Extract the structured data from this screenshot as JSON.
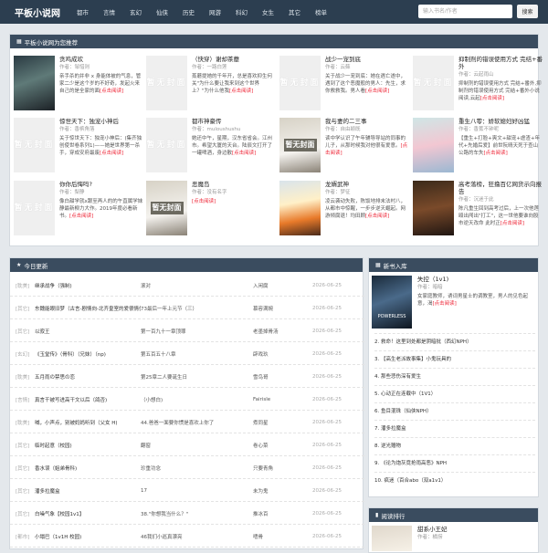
{
  "header": {
    "logo": "平板小说网",
    "nav": [
      "都市",
      "言情",
      "玄幻",
      "仙侠",
      "历史",
      "网游",
      "科幻",
      "女生",
      "其它",
      "榜单"
    ],
    "search_placeholder": "输入书名/作者",
    "search_button": "搜索"
  },
  "recommend": {
    "title": "平板小说网为您推荐",
    "books": [
      {
        "title": "贪鸡成欢",
        "author": "作者：邹惜则",
        "desc": "亲手杀的并非 x 身能体被的气息，管家二少是这个岁的不好奇，发起火来自己的是全家的面",
        "more": "[点击阅读]"
      },
      {
        "title": "（快穿）谢却茶蘼",
        "author": "作者：一路白莲",
        "desc": "蒸蘑提她的千年开，总是喜欢抑生何关\"为什么要让我来到这个世界上？\"为什么他我",
        "more": "[点击阅读]"
      },
      {
        "title": "战少一宠到底",
        "author": "作者：云藓",
        "desc": "关于战少一宠到底：她在遇亡遂中，遇到了这个恶魔般的男人：先生，求你救救我。男人看",
        "more": "[点击阅读]"
      },
      {
        "title": "抑制剂的错误使用方式 完结+番外",
        "author": "作者：云起雨山",
        "desc": "抑制剂的错误使用方式 完结+番外,抑制剂的错误使用方式 完结+番外小说阅读,云起",
        "more": "[点击阅读]"
      },
      {
        "title": "惊世天下：独宠小神后",
        "author": "作者：香槟角落",
        "desc": "关于惊世天下：独宠小神后：(集齐独创使世卷系列1)——她是世界第一杀手，穿成安府最废",
        "more": "[点击阅读]"
      },
      {
        "title": "都市神豪传",
        "author": "作者：muloushushu",
        "desc": "她还中午，星期，汉东省省会。江州市。希望大厦的天台。陆辰文打开了一罐啤酒，身边散",
        "more": "[点击阅读]"
      },
      {
        "title": "我与妻的二三事",
        "author": "作者：自由颖既",
        "desc": "读中学认识了午年辅导导站的同事的儿子，从那时候我对他很有爱意。",
        "more": "[点击阅读]"
      },
      {
        "title": "重生八零：娇软媳妇好凶猛",
        "author": "作者：香蕉不钟呢",
        "desc": "【重生+打脸+爽文+甜宠+虐渣+年代+先婚后爱】前世阮晴天死于查山公路的车失",
        "more": "[点击阅读]"
      },
      {
        "title": "你你后悔吗?",
        "author": "作者：梨静",
        "desc": "像白甜学就x跟至再人的的午直属学妹静最新柳力大作。2019年度必看新书。",
        "more": "[点击阅读]"
      },
      {
        "title": "恶魔岛",
        "author": "作者：没有名字",
        "desc": "",
        "more": "[点击阅读]"
      },
      {
        "title": "龙婿武神",
        "author": "作者：梦征",
        "desc": "凌云袭动失败，陈饭地排末法村八，从都市中惊醒，一步步逆天崛起。网游倾腐退！均田顾",
        "more": "[点击阅读]"
      },
      {
        "title": "高考落榜，狂撸百亿网货示向报告",
        "author": "作者：沉迷于此",
        "desc": "陈凡重生回到高考过后，上一次他莲殴出闯出\"打工\"，这一世他要谁向股市逆天改命 此时正",
        "more": "[点击阅读]"
      }
    ],
    "blank_cover_text": "暂无封面"
  },
  "today": {
    "title": "今日更新",
    "rows": [
      {
        "cat": "[耽美]",
        "name": "继承战争（强制)",
        "chap": "滚对",
        "auth": "入闲腐",
        "date": "2026-06-25"
      },
      {
        "cat": "[其它]",
        "name": "东魏能眼旧梦（古言-剧情向-北齐皇室的爱很情仇)",
        "chap": "73最后一年上元节（三）",
        "auth": "慕容满婉",
        "date": "2026-06-25"
      },
      {
        "cat": "[其它]",
        "name": "以寂王",
        "chap": "第一百九十一章顶罪",
        "auth": "老墨掉骨汤",
        "date": "2026-06-25"
      },
      {
        "cat": "[玄幻]",
        "name": "《玉堂传》（骨科）（兄妹）（np)",
        "chap": "第五百五十八章",
        "auth": "辟戏玖",
        "date": "2026-06-25"
      },
      {
        "cat": "[耽美]",
        "name": "五月雨の禁思の恋",
        "chap": "第25章二人要诞生日",
        "auth": "雪鸟哥",
        "date": "2026-06-25"
      },
      {
        "cat": "[言情]",
        "name": "真言干被写进高干文以后（鸽否)",
        "chap": "（小想白)",
        "auth": "Fairisle",
        "date": "2026-06-25"
      },
      {
        "cat": "[耽美]",
        "name": "喊，小声点，别被妈妈听到（父女 H)",
        "chap": "44.爸爸一面要你惯是喜欢上你了",
        "auth": "煮同星",
        "date": "2026-06-25"
      },
      {
        "cat": "[其它]",
        "name": "临时起意（校园)",
        "chap": "翻窗",
        "auth": "卷心菜",
        "date": "2026-06-25"
      },
      {
        "cat": "[其它]",
        "name": "香水误（姐弟骨科)",
        "chap": "珍重功念",
        "auth": "只要青角",
        "date": "2026-06-25"
      },
      {
        "cat": "[其它]",
        "name": "潘多拉魔盒",
        "chap": "17",
        "auth": "未为鬼",
        "date": "2026-06-25"
      },
      {
        "cat": "[其它]",
        "name": "白噪气象【校园1v1】",
        "chap": "38.\"你想我当什么？\"",
        "auth": "推冰百",
        "date": "2026-06-25"
      },
      {
        "cat": "[都市]",
        "name": "小塌巴（1v1H 校园)",
        "chap": "46我们小巡真漂亮",
        "auth": "嗜骨",
        "date": "2026-06-25"
      }
    ]
  },
  "newin": {
    "title": "新书入库",
    "top": {
      "title": "失控（1v1)",
      "author": "作者：暗暗",
      "desc": "女家庭教师，诱词男星士的调教室，男人的见色起意，渴",
      "more": "[点击阅读]",
      "cover_text": "POWERLESS"
    },
    "items": [
      "2. 救命！这里到处都是阴暗批（西幻NPH）",
      "3. 【高生老派故事集】小鬼玩具的",
      "4. 那些悲伤深有爱生",
      "5. 心动正在连载中（1V1）",
      "6. 鱼目混珠（仙侠NPH）",
      "7. 潘多拉魔盒",
      "8. 逆光赠物",
      "9. 《论为炮灰竟抢雨高恶》NPH",
      "10. 疯迷（百合abo（双a1v1）"
    ]
  },
  "rank": {
    "title": "阅读排行",
    "top": {
      "title": "甜系小王妃",
      "author": "作者：橘捞"
    }
  }
}
